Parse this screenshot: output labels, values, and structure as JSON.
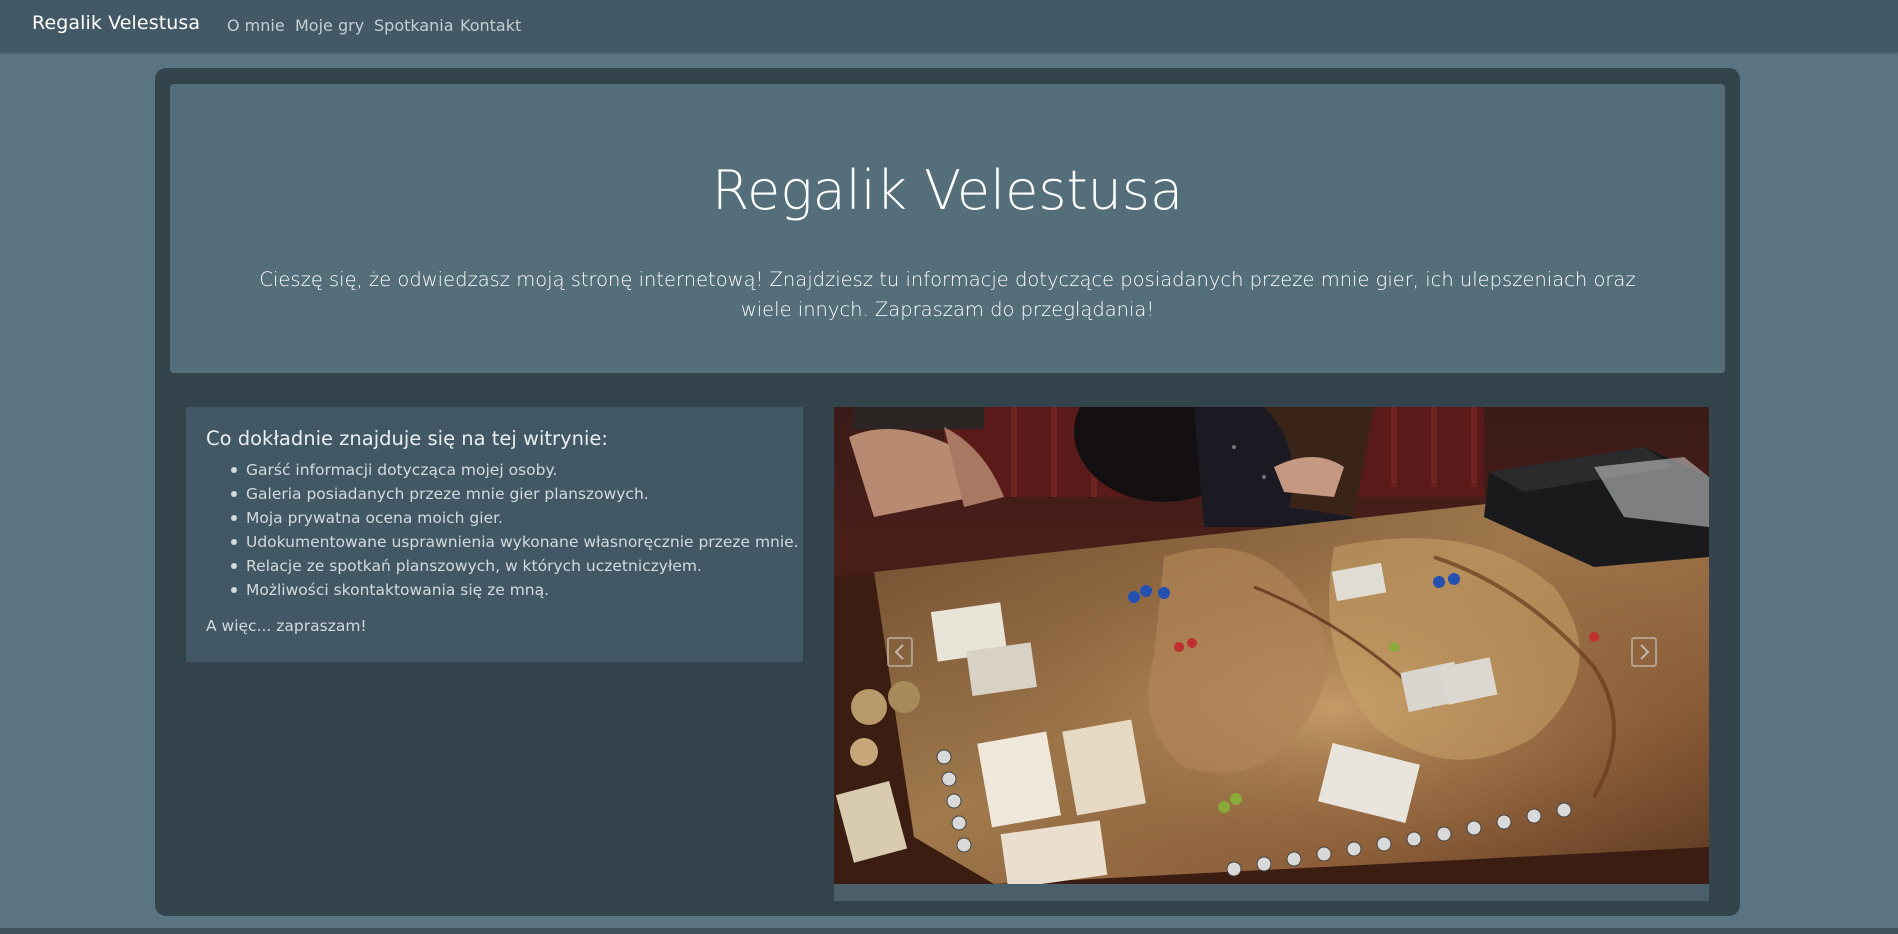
{
  "navbar": {
    "brand": "Regalik Velestusa",
    "links": [
      "O mnie",
      "Moje gry",
      "Spotkania",
      "Kontakt"
    ]
  },
  "hero": {
    "title": "Regalik Velestusa",
    "text": "Cieszę się, że odwiedzasz moją stronę internetową! Znajdziesz tu informacje dotyczące posiadanych przeze mnie gier, ich ulepszeniach oraz wiele innych. Zapraszam do przeglądania!"
  },
  "info": {
    "heading": "Co dokładnie znajduje się na tej witrynie:",
    "items": [
      "Garść informacji dotycząca mojej osoby.",
      "Galeria posiadanych przeze mnie gier planszowych.",
      "Moja prywatna ocena moich gier.",
      "Udokumentowane usprawnienia wykonane własnoręcznie przeze mnie.",
      "Relacje ze spotkań planszowych, w których uczetniczyłem.",
      "Możliwości skontaktowania się ze mną."
    ],
    "outro": "A więc... zapraszam!"
  },
  "carousel": {
    "prev_icon": "chevron-left-icon",
    "next_icon": "chevron-right-icon"
  },
  "colors": {
    "page_bg": "#5a7481",
    "navbar_bg": "#435a66",
    "container_bg": "#34444d",
    "jumbotron_bg": "#546e7a",
    "card_bg": "#435865"
  }
}
